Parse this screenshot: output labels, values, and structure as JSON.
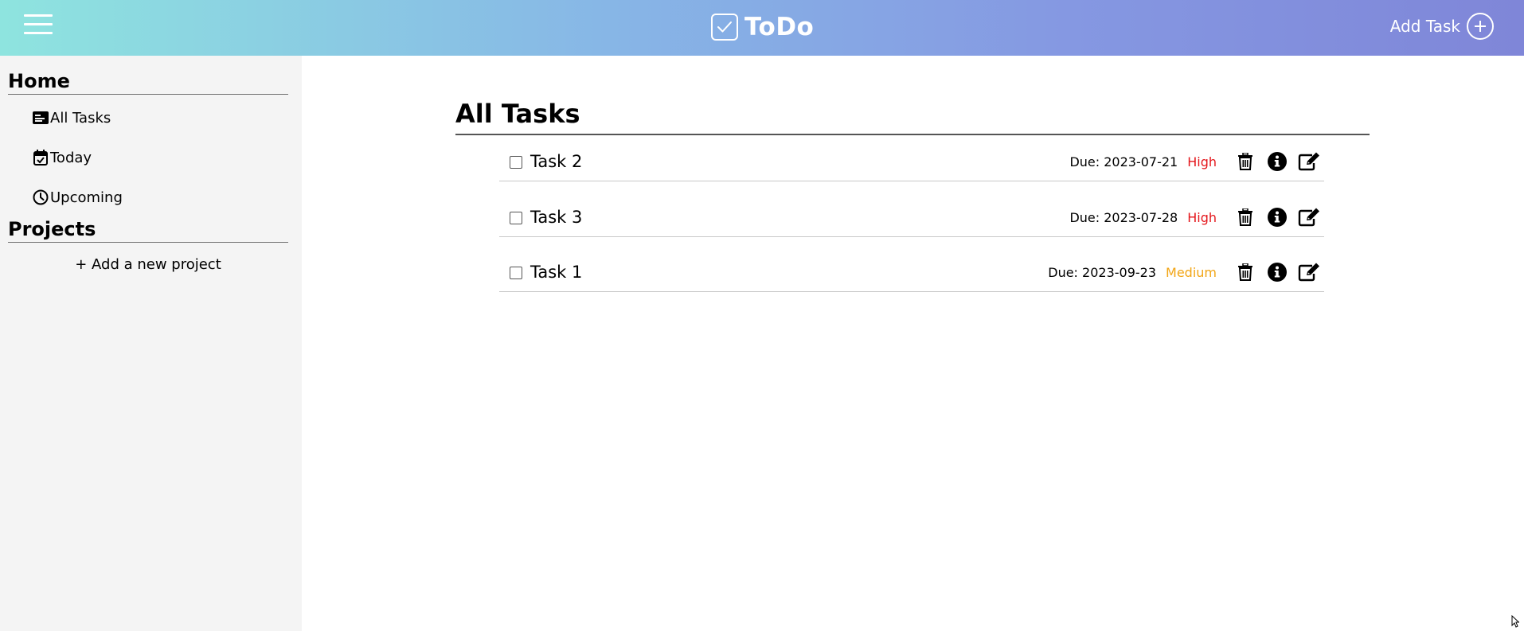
{
  "header": {
    "title": "ToDo",
    "add_task_label": "Add Task",
    "gradient_colors": [
      "#8ee4df",
      "#87b6e6",
      "#8598e2",
      "#7f86d8"
    ]
  },
  "sidebar": {
    "home_title": "Home",
    "items": [
      {
        "label": "All Tasks",
        "icon": "tasks-card-icon"
      },
      {
        "label": "Today",
        "icon": "calendar-check-icon"
      },
      {
        "label": "Upcoming",
        "icon": "clock-icon"
      }
    ],
    "projects_title": "Projects",
    "add_project_label": "+ Add a new project"
  },
  "main": {
    "title": "All Tasks",
    "tasks": [
      {
        "name": "Task 2",
        "due": "Due: 2023-07-21",
        "priority": "High",
        "priority_color": "#e4161b",
        "checked": false
      },
      {
        "name": "Task 3",
        "due": "Due: 2023-07-28",
        "priority": "High",
        "priority_color": "#e4161b",
        "checked": false
      },
      {
        "name": "Task 1",
        "due": "Due: 2023-09-23",
        "priority": "Medium",
        "priority_color": "#f2a515",
        "checked": false
      }
    ]
  },
  "colors": {
    "sidebar_bg": "#f4f4f4",
    "high": "#e4161b",
    "medium": "#f2a515"
  }
}
